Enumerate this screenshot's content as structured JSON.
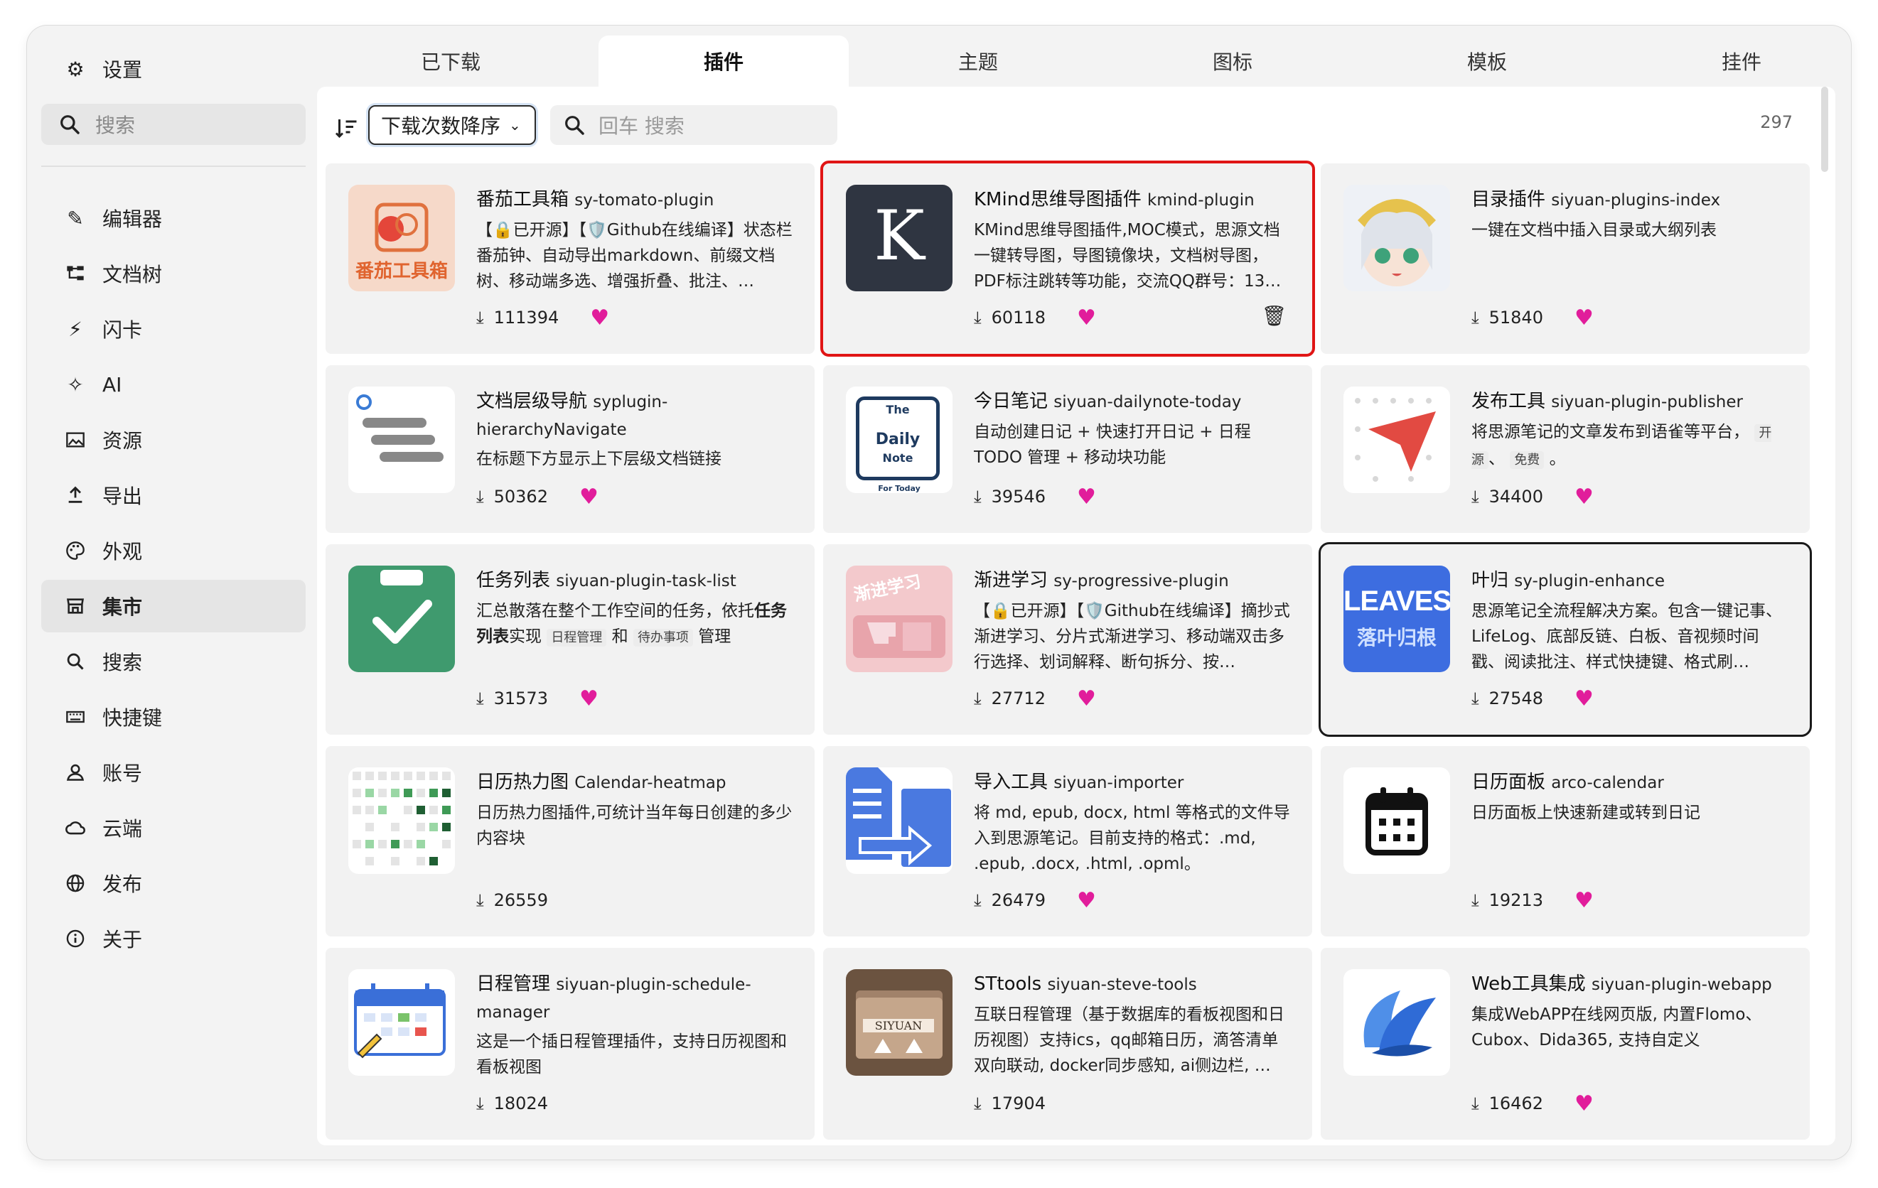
{
  "sidebar": {
    "settings": "设置",
    "search_placeholder": "搜索",
    "items": [
      {
        "label": "编辑器",
        "icon": "pencil-icon"
      },
      {
        "label": "文档树",
        "icon": "tree-icon"
      },
      {
        "label": "闪卡",
        "icon": "flash-icon"
      },
      {
        "label": "AI",
        "icon": "sparkle-icon"
      },
      {
        "label": "资源",
        "icon": "image-icon"
      },
      {
        "label": "导出",
        "icon": "upload-icon"
      },
      {
        "label": "外观",
        "icon": "palette-icon"
      },
      {
        "label": "集市",
        "icon": "store-icon"
      },
      {
        "label": "搜索",
        "icon": "search-icon"
      },
      {
        "label": "快捷键",
        "icon": "keyboard-icon"
      },
      {
        "label": "账号",
        "icon": "user-icon"
      },
      {
        "label": "云端",
        "icon": "cloud-icon"
      },
      {
        "label": "发布",
        "icon": "globe-icon"
      },
      {
        "label": "关于",
        "icon": "info-icon"
      }
    ]
  },
  "tabs": [
    "已下载",
    "插件",
    "主题",
    "图标",
    "模板",
    "挂件"
  ],
  "toolbar": {
    "sort_value": "下载次数降序",
    "search_placeholder": "回车 搜索",
    "count": "297"
  },
  "plugins": [
    {
      "name": "番茄工具箱",
      "pkg": "sy-tomato-plugin",
      "desc": "【🔒已开源】【🛡️Github在线编译】状态栏番茄钟、自动导出markdown、前缀文档树、移动端多选、增强折叠、批注、…",
      "downloads": "111394",
      "thumb_text": "番茄工具箱"
    },
    {
      "name": "KMind思维导图插件",
      "pkg": "kmind-plugin",
      "desc": "KMind思维导图插件,MOC模式，思源文档一键转导图，导图镜像块，文档树导图，PDF标注跳转等功能，交流QQ群号：13…",
      "downloads": "60118",
      "thumb_text": "K"
    },
    {
      "name": "目录插件",
      "pkg": "siyuan-plugins-index",
      "desc": "一键在文档中插入目录或大纲列表",
      "downloads": "51840"
    },
    {
      "name": "文档层级导航",
      "pkg": "syplugin-hierarchyNavigate",
      "desc": "在标题下方显示上下层级文档链接",
      "downloads": "50362"
    },
    {
      "name": "今日笔记",
      "pkg": "siyuan-dailynote-today",
      "desc": "自动创建日记 + 快速打开日记 + 日程 TODO 管理 + 移动块功能",
      "downloads": "39546",
      "thumb_text": {
        "top": "The",
        "mid": "Daily",
        "note": "Note",
        "bottom": "For Today"
      }
    },
    {
      "name": "发布工具",
      "pkg": "siyuan-plugin-publisher",
      "desc": "将思源笔记的文章发布到语雀等平台，",
      "tag1": "开源",
      "sep": "、",
      "tag2": "免费",
      "end": "。",
      "downloads": "34400"
    },
    {
      "name": "任务列表",
      "pkg": "siyuan-plugin-task-list",
      "desc_a": "汇总散落在整个工作空间的任务，依托",
      "desc_b": "任务列表",
      "desc_c": "实现",
      "tag1": "日程管理",
      "mid": "和",
      "tag2": "待办事项",
      "end": "管理",
      "downloads": "31573"
    },
    {
      "name": "渐进学习",
      "pkg": "sy-progressive-plugin",
      "desc": "【🔒已开源】【🛡️Github在线编译】摘抄式渐进学习、分片式渐进学习、移动端双击多行选择、划词解释、断句拆分、按…",
      "downloads": "27712",
      "thumb_text": "渐进学习"
    },
    {
      "name": "叶归",
      "pkg": "sy-plugin-enhance",
      "desc": "思源笔记全流程解决方案。包含一键记事、LifeLog、底部反链、白板、音视频时间戳、阅读批注、样式快捷键、格式刷…",
      "downloads": "27548",
      "thumb_text": {
        "top": "LEAVES",
        "bottom": "落叶归根"
      }
    },
    {
      "name": "日历热力图",
      "pkg": "Calendar-heatmap",
      "desc": "日历热力图插件,可统计当年每日创建的多少内容块",
      "downloads": "26559"
    },
    {
      "name": "导入工具",
      "pkg": "siyuan-importer",
      "desc": "将 md, epub, docx, html 等格式的文件导入到思源笔记。目前支持的格式：.md, .epub, .docx, .html, .opml。",
      "downloads": "26479"
    },
    {
      "name": "日历面板",
      "pkg": "arco-calendar",
      "desc": "日历面板上快速新建或转到日记",
      "downloads": "19213"
    },
    {
      "name": "日程管理",
      "pkg": "siyuan-plugin-schedule-manager",
      "desc": "这是一个插日程管理插件，支持日历视图和看板视图",
      "downloads": "18024"
    },
    {
      "name": "STtools",
      "pkg": "siyuan-steve-tools",
      "desc": "互联日程管理（基于数据库的看板视图和日历视图）支持ics，qq邮箱日历，滴答清单双向联动, docker同步感知, ai侧边栏, …",
      "downloads": "17904",
      "thumb_text": "SIYUAN"
    },
    {
      "name": "Web工具集成",
      "pkg": "siyuan-plugin-webapp",
      "desc": "集成WebAPP在线网页版, 内置Flomo、Cubox、Dida365, 支持自定义",
      "downloads": "16462"
    }
  ],
  "colors": {
    "accent_heart": "#e11d9b",
    "highlight": "#e01515",
    "tomato_bg": "#f6d9c9",
    "kmind_bg": "#2f3541",
    "task_green": "#3f9a6e",
    "leaves_blue": "#3d6de0"
  }
}
